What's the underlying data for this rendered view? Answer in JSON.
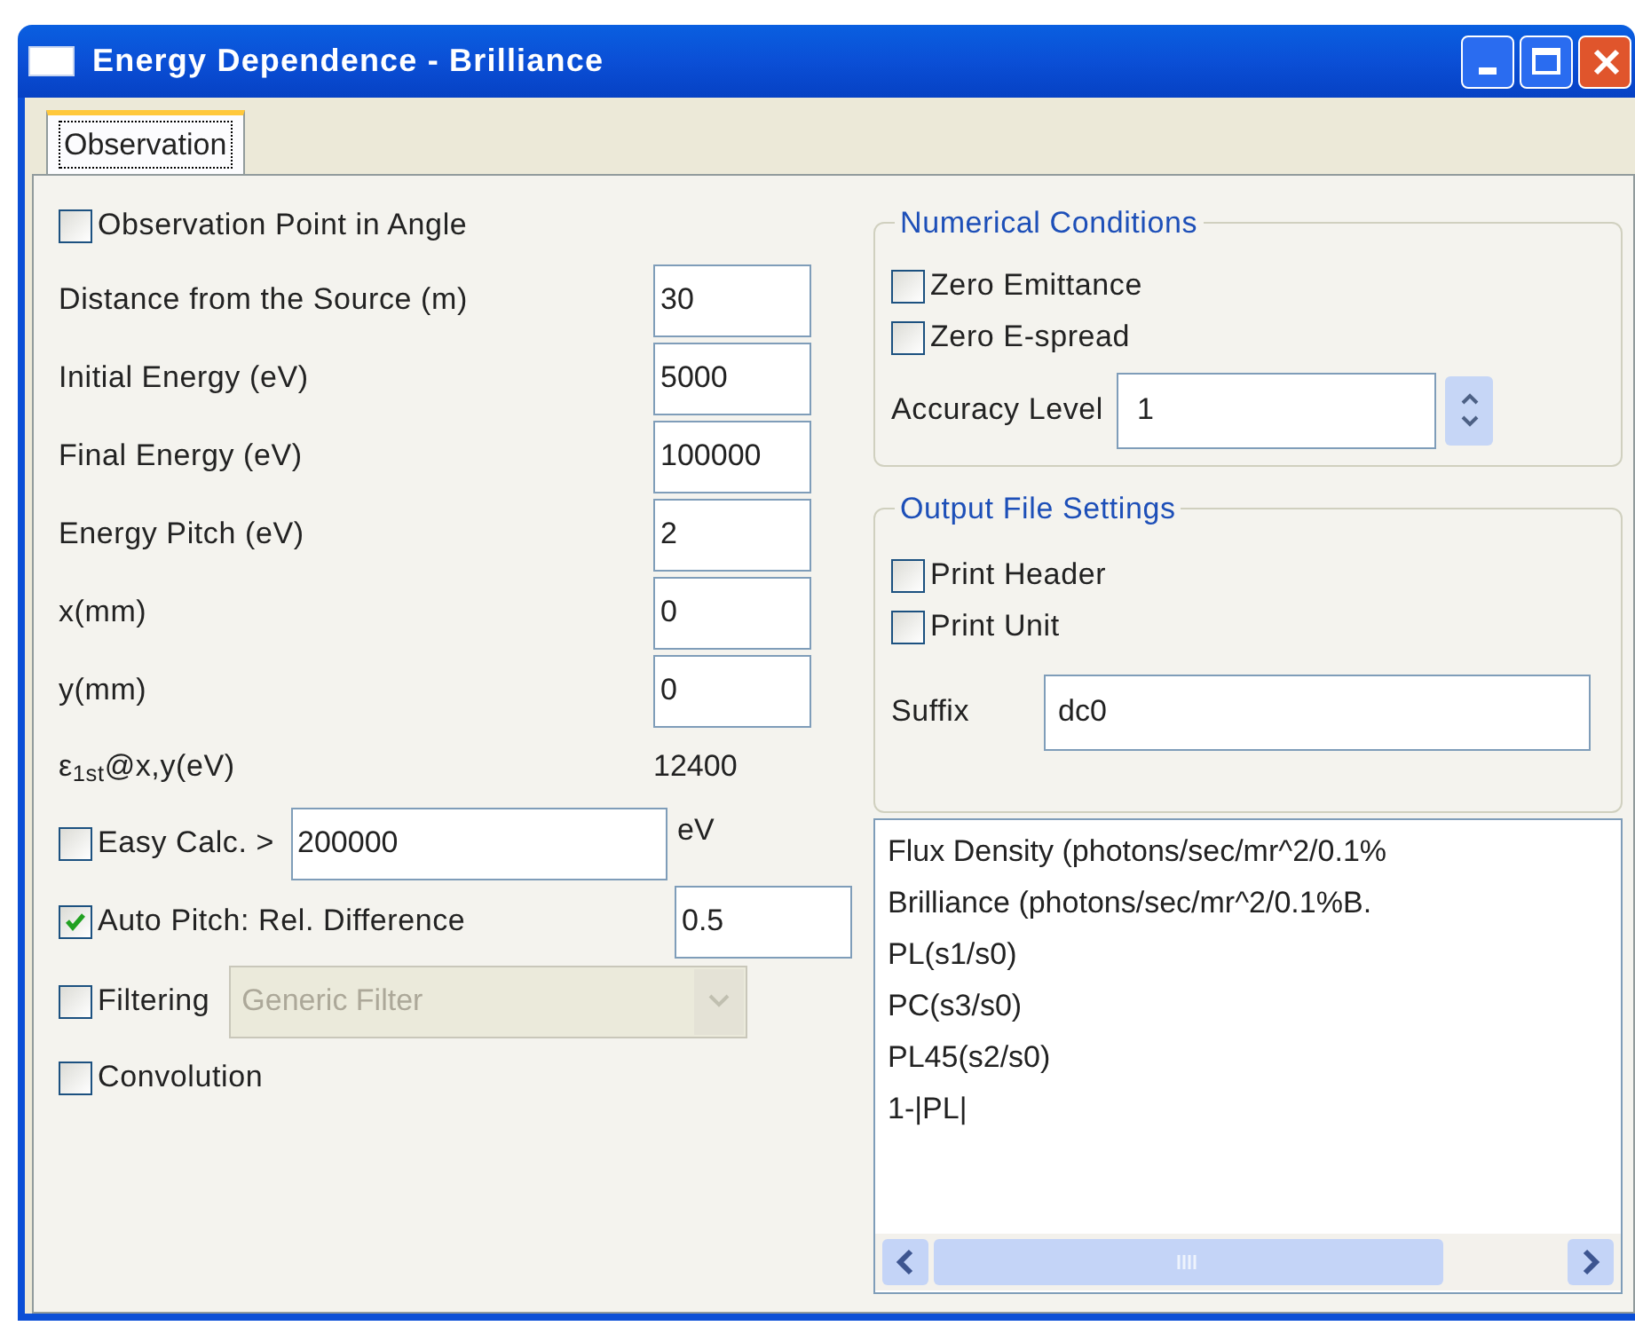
{
  "window": {
    "title": "Energy Dependence - Brilliance"
  },
  "tabs": [
    {
      "label": "Observation",
      "selected": true
    }
  ],
  "left_form": [
    {
      "kind": "checkbox",
      "label": "Observation Point in Angle",
      "checked": false
    },
    {
      "kind": "field",
      "label": "Distance from the Source (m)",
      "value": "30"
    },
    {
      "kind": "field",
      "label": "Initial Energy (eV)",
      "value": "5000"
    },
    {
      "kind": "field",
      "label": "Final Energy (eV)",
      "value": "100000"
    },
    {
      "kind": "field",
      "label": "Energy Pitch (eV)",
      "value": "2"
    },
    {
      "kind": "field",
      "label": "x(mm)",
      "value": "0"
    },
    {
      "kind": "field",
      "label": "y(mm)",
      "value": "0"
    },
    {
      "kind": "readout",
      "label": "ε$_{1st}$@x,y(eV)",
      "value": "12400"
    },
    {
      "kind": "checkbox_field",
      "label": "Easy Calc. >",
      "checked": false,
      "value": "200000",
      "unit": "eV"
    },
    {
      "kind": "checkbox_field",
      "label": "Auto Pitch: Rel. Difference",
      "checked": true,
      "value": "0.5"
    },
    {
      "kind": "checkbox_select",
      "label": "Filtering",
      "checked": false,
      "value": "Generic Filter",
      "disabled": true
    },
    {
      "kind": "checkbox",
      "label": "Convolution",
      "checked": false
    }
  ],
  "numerical_conditions": {
    "title": "Numerical Conditions",
    "checkboxes": [
      {
        "label": "Zero Emittance",
        "checked": false
      },
      {
        "label": "Zero E-spread",
        "checked": false
      }
    ],
    "accuracy_level": {
      "label": "Accuracy Level",
      "value": "1"
    }
  },
  "output_file_settings": {
    "title": "Output File Settings",
    "checkboxes": [
      {
        "label": "Print Header",
        "checked": false
      },
      {
        "label": "Print Unit",
        "checked": false
      }
    ],
    "suffix": {
      "label": "Suffix",
      "value": "dc0"
    }
  },
  "output_list": [
    "Flux Density (photons/sec/mr^2/0.1%",
    "Brilliance (photons/sec/mr^2/0.1%B.",
    "PL(s1/s0)",
    "PC(s3/s0)",
    "PL45(s2/s0)",
    "1-|PL|"
  ]
}
